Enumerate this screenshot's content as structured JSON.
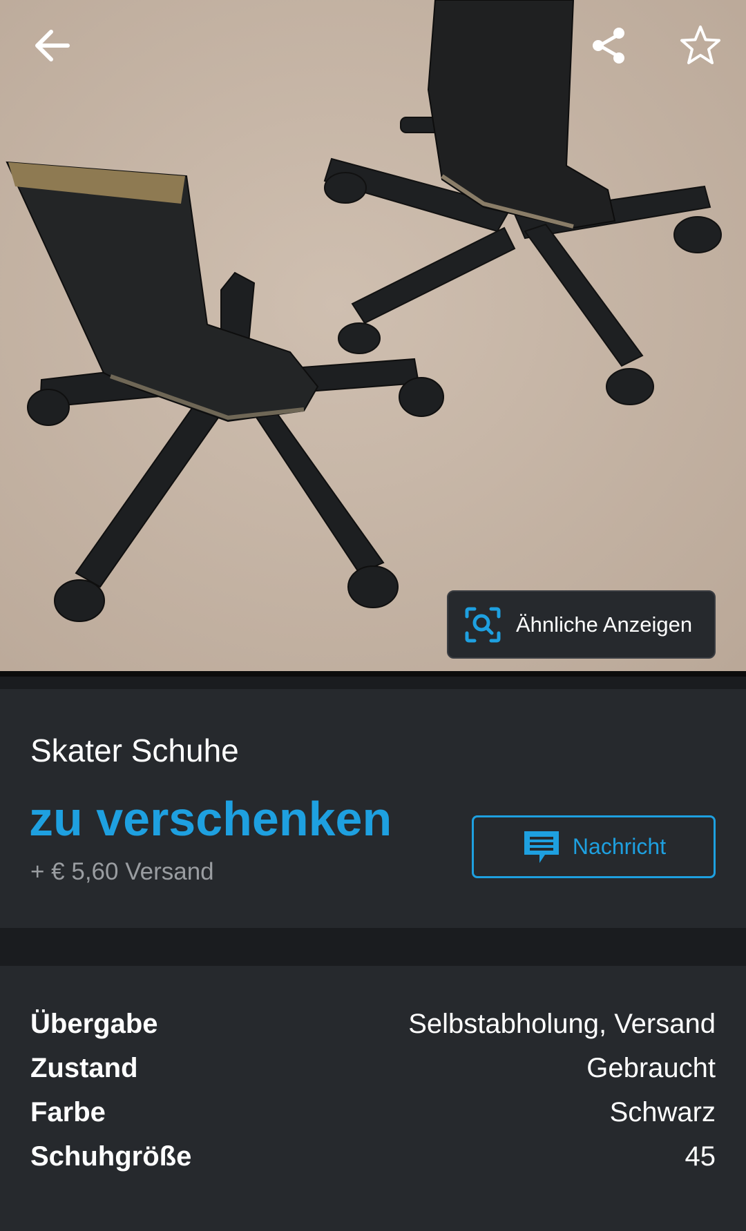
{
  "photo": {
    "alt": "Skater Schuhe",
    "similar_ads_label": "Ähnliche Anzeigen"
  },
  "topbar": {
    "back_icon": "arrow-left-icon",
    "share_icon": "share-icon",
    "favorite_icon": "star-outline-icon"
  },
  "listing": {
    "title": "Skater Schuhe",
    "price": "zu verschenken",
    "shipping": "+ € 5,60 Versand",
    "message_button_label": "Nachricht",
    "message_icon": "chat-bubble-icon"
  },
  "details": [
    {
      "key": "Übergabe",
      "value": "Selbstabholung, Versand"
    },
    {
      "key": "Zustand",
      "value": "Gebraucht"
    },
    {
      "key": "Farbe",
      "value": "Schwarz"
    },
    {
      "key": "Schuhgröße",
      "value": "45"
    }
  ],
  "colors": {
    "accent": "#1ea0e0",
    "background": "#26292d",
    "separator": "#1a1c1f",
    "text": "#ffffff",
    "muted_text": "#9a9da1"
  }
}
